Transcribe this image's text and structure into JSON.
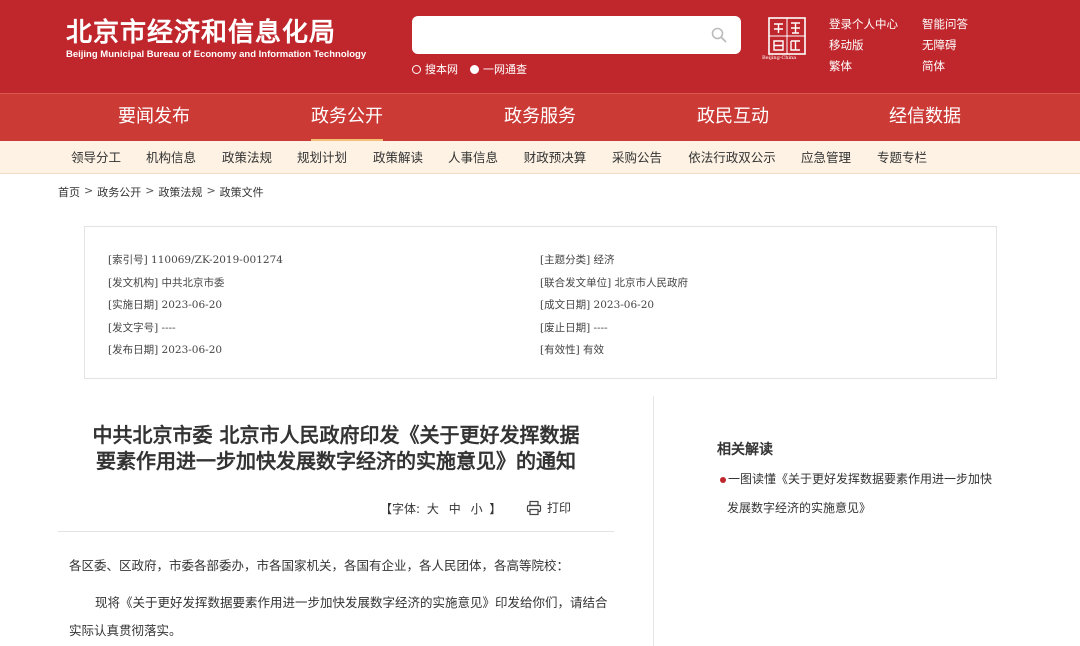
{
  "header": {
    "logo_cn": "北京市经济和信息化局",
    "logo_en": "Beijing Municipal Bureau of Economy and Information Technology",
    "search_placeholder": "",
    "scope_options": [
      "搜本网",
      "一网通查"
    ],
    "emblem_text": "Beijing·China",
    "links_col1": [
      "登录个人中心",
      "移动版",
      "繁体"
    ],
    "links_col2": [
      "智能问答",
      "无障碍",
      "简体"
    ]
  },
  "mainnav": [
    "要闻发布",
    "政务公开",
    "政务服务",
    "政民互动",
    "经信数据"
  ],
  "mainnav_active": "政务公开",
  "subnav": [
    "领导分工",
    "机构信息",
    "政策法规",
    "规划计划",
    "政策解读",
    "人事信息",
    "财政预决算",
    "采购公告",
    "依法行政双公示",
    "应急管理",
    "专题专栏"
  ],
  "breadcrumb": [
    "首页",
    "政务公开",
    "政策法规",
    "政策文件"
  ],
  "info": {
    "left": [
      "[索引号] 110069/ZK-2019-001274",
      "[发文机构] 中共北京市委",
      "[实施日期] 2023-06-20",
      "[发文字号] ----",
      "[发布日期] 2023-06-20"
    ],
    "right": [
      "[主题分类] 经济",
      "[联合发文单位] 北京市人民政府",
      "[成文日期] 2023-06-20",
      "[废止日期] ----",
      "[有效性] 有效"
    ]
  },
  "article": {
    "title_line1": "中共北京市委 北京市人民政府印发《关于更好发挥数据",
    "title_line2": "要素作用进一步加快发展数字经济的实施意见》的通知",
    "font_label_open": "【字体:",
    "font_sizes": [
      "大",
      "中",
      "小"
    ],
    "font_label_close": "】",
    "print_label": "打印",
    "para1": "各区委、区政府，市委各部委办，市各国家机关，各国有企业，各人民团体，各高等院校：",
    "para2": "现将《关于更好发挥数据要素作用进一步加快发展数字经济的实施意见》印发给你们，请结合实际认真贯彻落实。"
  },
  "sidebar": {
    "title": "相关解读",
    "link_line1": "一图读懂《关于更好发挥数据要素作用进一步加快",
    "link_line2": "发展数字经济的实施意见》"
  },
  "colors": {
    "brand_red": "#c0272d",
    "nav_red": "#cc3a36",
    "subnav_bg": "#fdf2e3",
    "active_underline": "#f4c178"
  }
}
